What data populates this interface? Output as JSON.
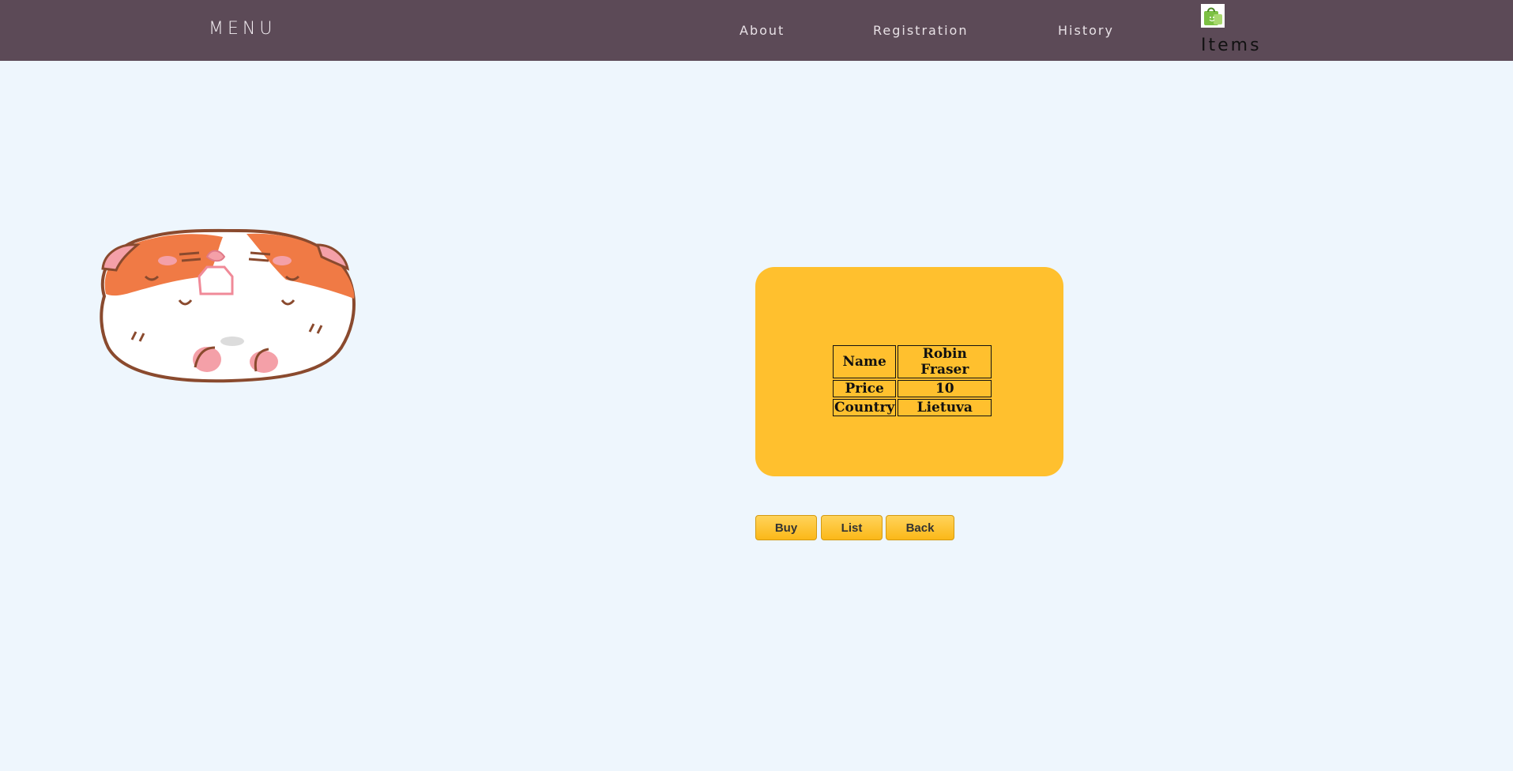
{
  "nav": {
    "brand": "MENU",
    "links": [
      {
        "label": "About"
      },
      {
        "label": "Registration"
      },
      {
        "label": "History"
      }
    ],
    "items_label": "Items",
    "items_icon": "shopping-bag-icon"
  },
  "illustration": {
    "subject": "hamster",
    "colors": {
      "fur_orange": "#f07a45",
      "outline": "#8a4a2e",
      "pink": "#f4a0a8"
    }
  },
  "item": {
    "rows": [
      {
        "label": "Name",
        "value": "Robin Fraser"
      },
      {
        "label": "Price",
        "value": "10"
      },
      {
        "label": "Country",
        "value": "Lietuva"
      }
    ]
  },
  "actions": {
    "buy_label": "Buy",
    "list_label": "List",
    "back_label": "Back"
  },
  "colors": {
    "navbar": "#5c4a57",
    "background": "#eef6fd",
    "card": "#ffc02e",
    "button": "#fbb818"
  }
}
